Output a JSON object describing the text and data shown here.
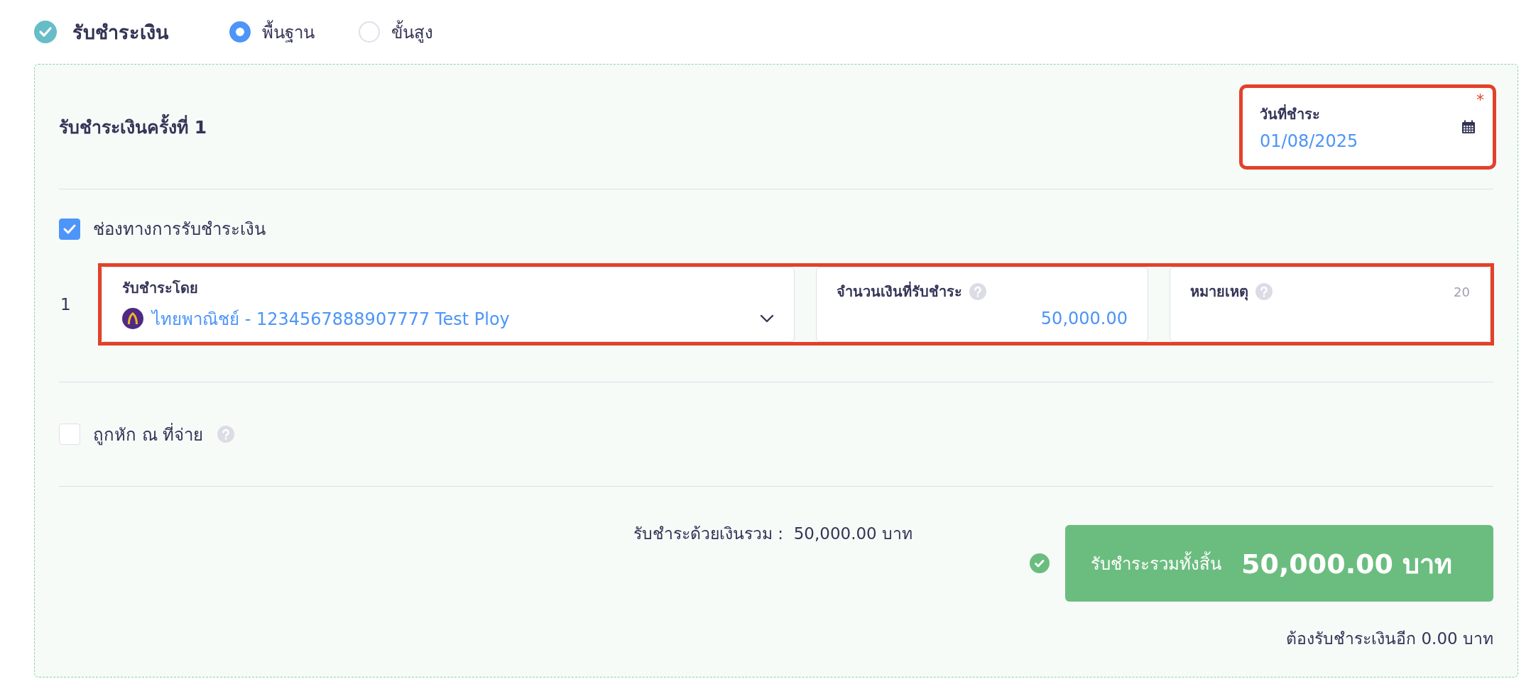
{
  "header": {
    "title": "รับชำระเงิน",
    "checked": true,
    "modes": [
      {
        "label": "พื้นฐาน",
        "selected": true
      },
      {
        "label": "ขั้นสูง",
        "selected": false
      }
    ]
  },
  "payment": {
    "title": "รับชำระเงินครั้งที่ 1",
    "date_field": {
      "label": "วันที่ชำระ",
      "value": "01/08/2025",
      "required_mark": "*",
      "highlighted": true
    },
    "channels_checkbox": {
      "label": "ช่องทางการรับชำระเงิน",
      "checked": true
    },
    "rows": [
      {
        "number": "1",
        "highlighted": true,
        "method": {
          "label": "รับชำระโดย",
          "value": "ไทยพาณิชย์ - 1234567888907777 Test Ploy"
        },
        "amount": {
          "label": "จำนวนเงินที่รับชำระ",
          "value": "50,000.00"
        },
        "note": {
          "label": "หมายเหตุ",
          "counter": "20"
        }
      }
    ],
    "withholding_checkbox": {
      "label": "ถูกหัก ณ ที่จ่าย",
      "checked": false
    },
    "summary": {
      "subtotal": "รับชำระด้วยเงินรวม :  50,000.00 บาท",
      "total_label": "รับชำระรวมทั้งสิ้น",
      "total_value": "50,000.00 บาท",
      "complete": true,
      "remaining": "ต้องรับชำระเงินอีก 0.00 บาท"
    }
  }
}
